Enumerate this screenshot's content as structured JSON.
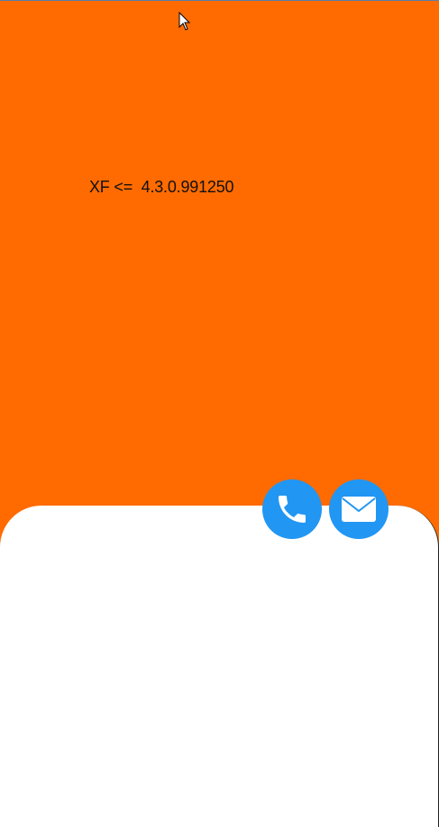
{
  "app": {
    "version_text": "XF <=  4.3.0.991250"
  },
  "actions": {
    "call_icon": "phone-icon",
    "mail_icon": "mail-icon"
  },
  "colors": {
    "header_bg": "#FF6B00",
    "sheet_bg": "#FFFFFF",
    "fab_bg": "#2196F3",
    "icon_fg": "#FFFFFF"
  }
}
